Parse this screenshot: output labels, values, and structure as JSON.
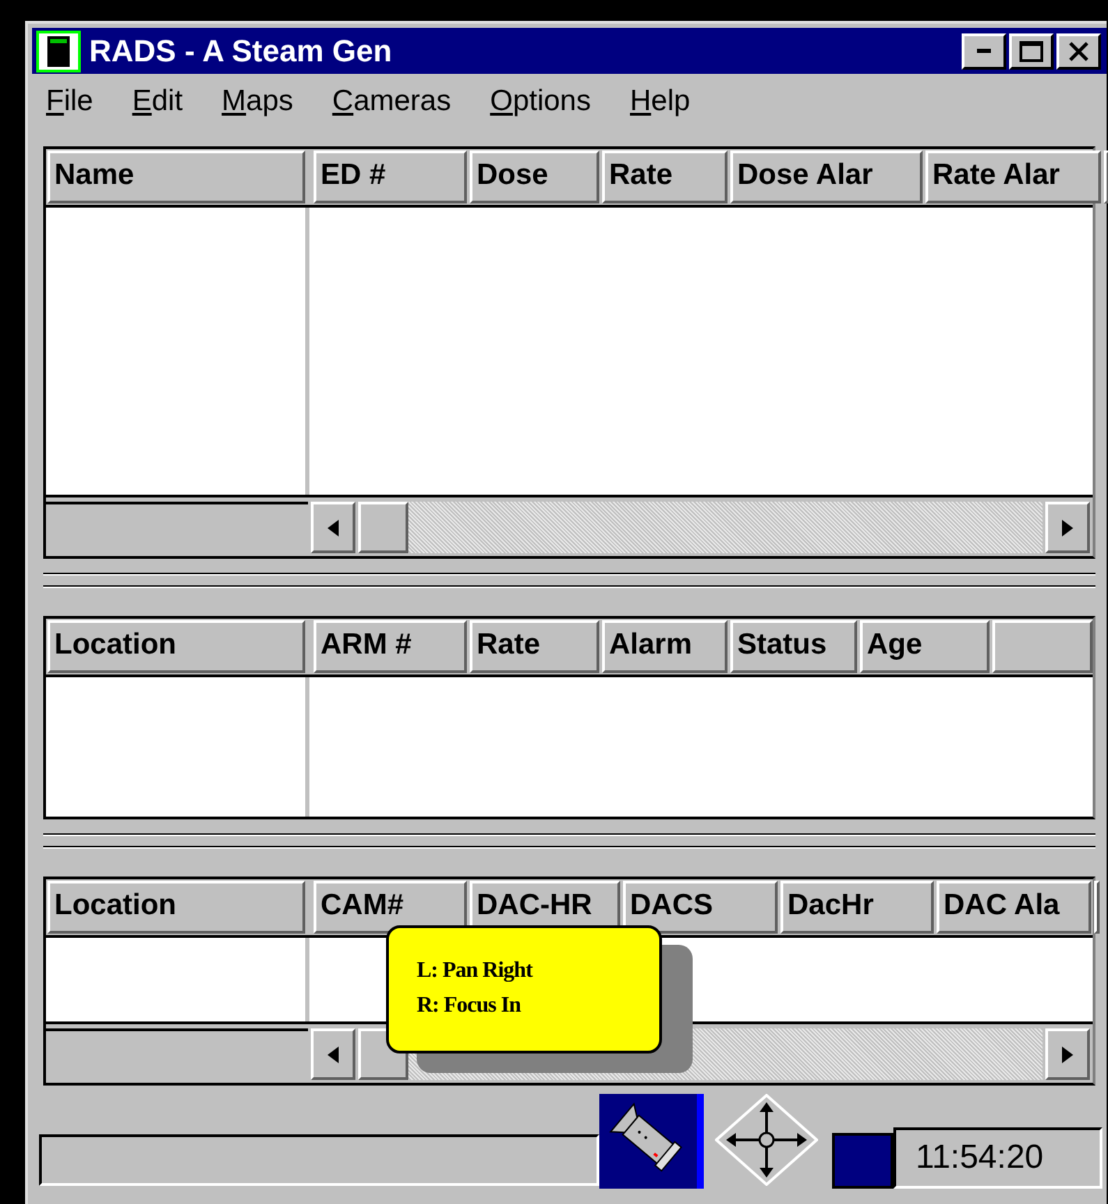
{
  "window": {
    "title": "RADS - A Steam Gen"
  },
  "menu": [
    "File",
    "Edit",
    "Maps",
    "Cameras",
    "Options",
    "Help"
  ],
  "grids": [
    {
      "columns": [
        "Name",
        "ED #",
        "Dose",
        "Rate",
        "Dose Alar",
        "Rate Alar"
      ],
      "horizontal_scrollbar": true
    },
    {
      "columns": [
        "Location",
        "ARM #",
        "Rate",
        "Alarm",
        "Status",
        "Age"
      ],
      "horizontal_scrollbar": false
    },
    {
      "columns": [
        "Location",
        "CAM#",
        "DAC-HR",
        "DACS",
        "DacHr",
        "DAC Ala"
      ],
      "horizontal_scrollbar": true
    }
  ],
  "tooltip": {
    "lines": [
      "L: Pan Right",
      "R: Focus In"
    ]
  },
  "status_bar": {
    "time": "11:54:20"
  }
}
